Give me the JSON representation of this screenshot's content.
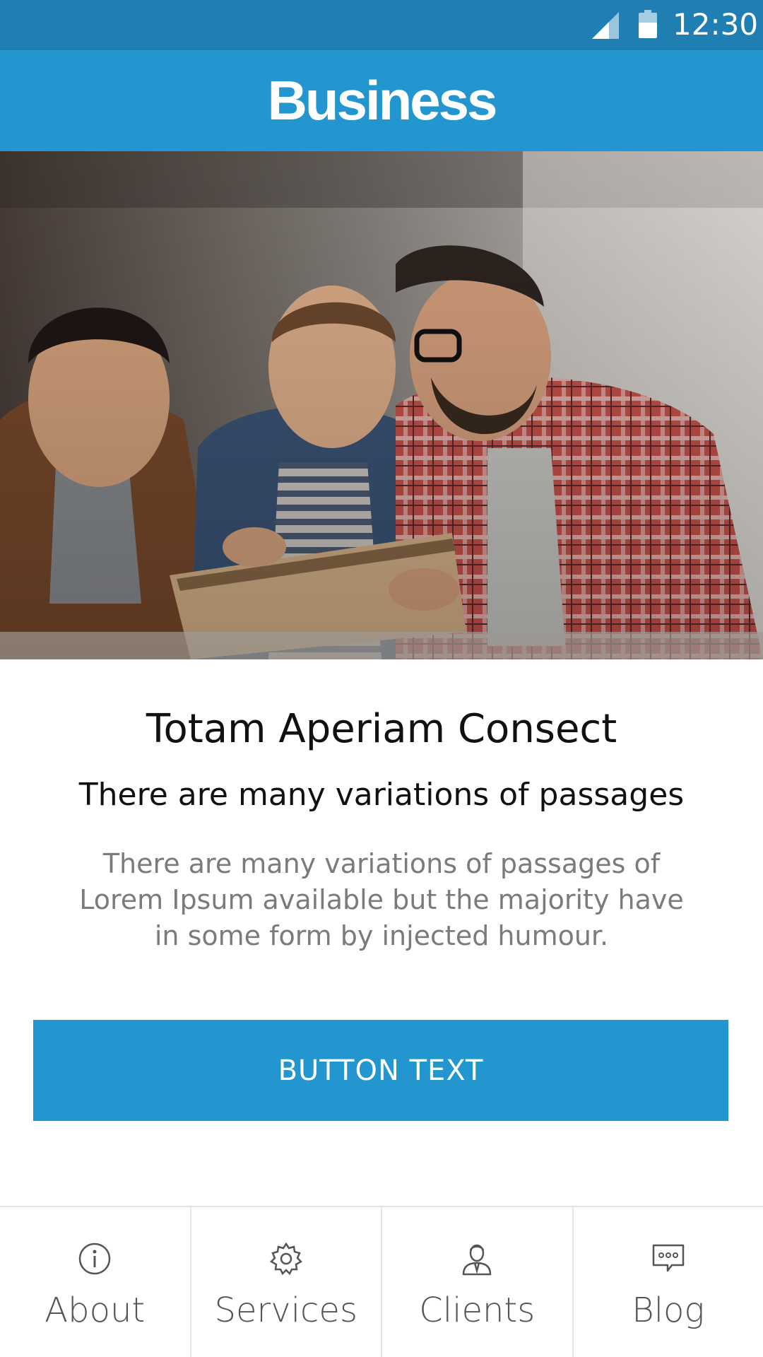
{
  "status_bar": {
    "time": "12:30",
    "icons": [
      "signal-icon",
      "battery-icon"
    ]
  },
  "header": {
    "title": "Business"
  },
  "hero": {
    "image": "photo of three smiling young men looking at a notebook"
  },
  "content": {
    "headline": "Totam Aperiam Consect",
    "subhead": "There are many variations of passages",
    "body": "There are many variations of passages of Lorem Ipsum available but the majority have in some form by injected humour.",
    "button_label": "BUTTON TEXT"
  },
  "tabs": [
    {
      "label": "About",
      "icon": "info-icon"
    },
    {
      "label": "Services",
      "icon": "gear-icon"
    },
    {
      "label": "Clients",
      "icon": "user-icon"
    },
    {
      "label": "Blog",
      "icon": "chat-bubble-icon"
    }
  ],
  "colors": {
    "status_bar": "#1f7fb3",
    "accent": "#2396d0",
    "body_text": "#7b7b7b"
  }
}
